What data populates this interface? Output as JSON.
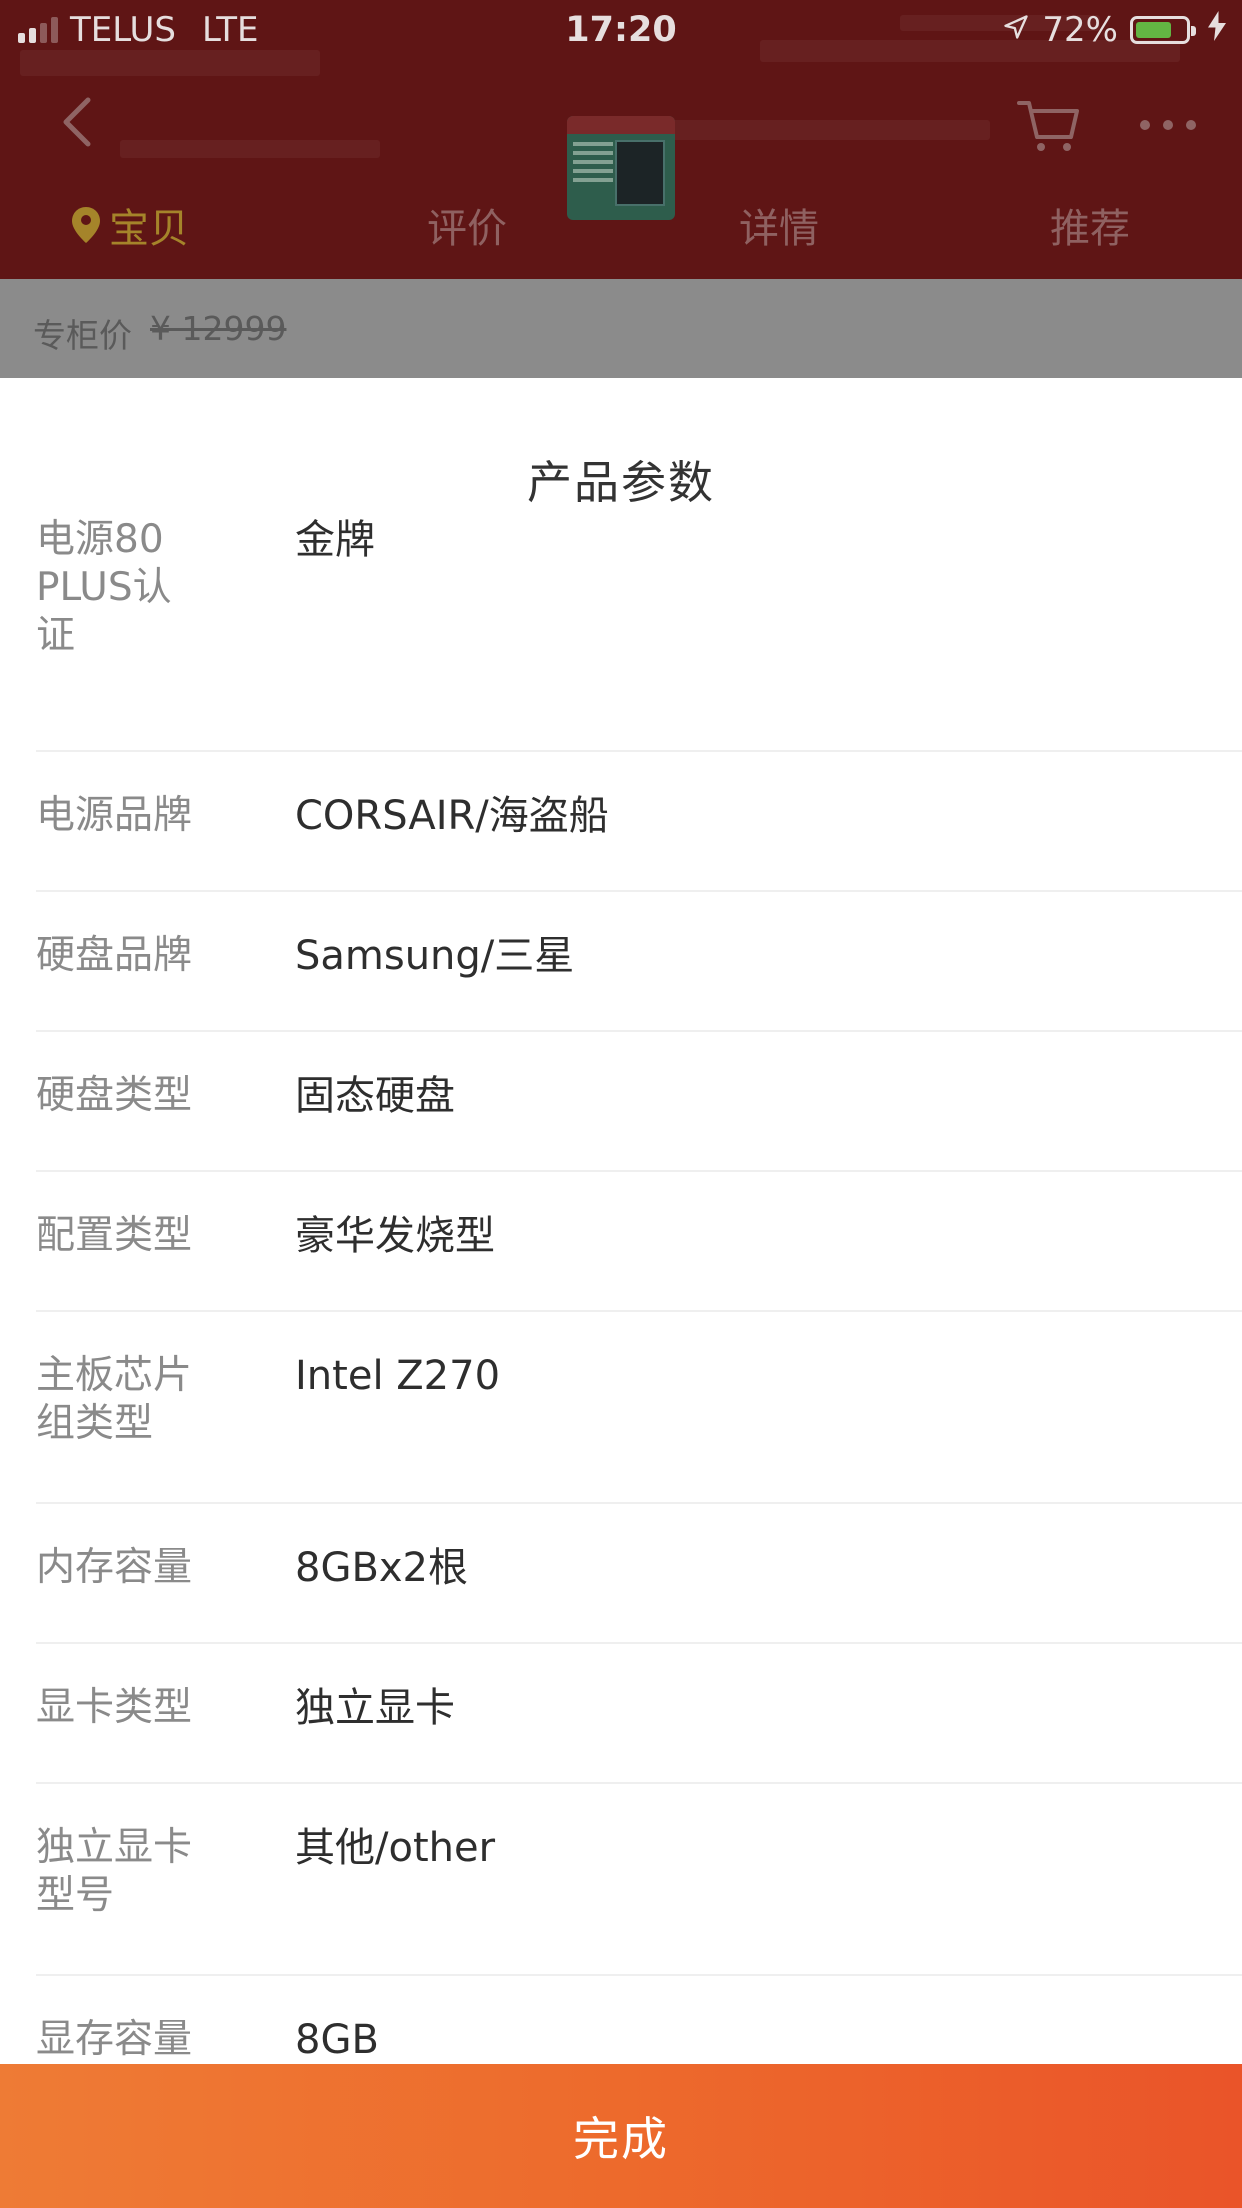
{
  "status_bar": {
    "carrier": "TELUS",
    "network": "LTE",
    "time": "17:20",
    "battery": "72%",
    "battery_level": 0.72
  },
  "nav": {
    "back_icon": "chevron-left-icon",
    "thumbnail": "product-thumbnail",
    "cart_icon": "cart-icon",
    "more_icon": "more-icon"
  },
  "tabs": [
    {
      "label": "宝贝",
      "active": true
    },
    {
      "label": "评价",
      "active": false
    },
    {
      "label": "详情",
      "active": false
    },
    {
      "label": "推荐",
      "active": false
    }
  ],
  "price_strip": {
    "label": "专柜价",
    "price": "¥ 12999"
  },
  "sheet": {
    "title": "产品参数",
    "params": [
      {
        "key": "电源80\nPLUS认\n证",
        "value": "金牌"
      },
      {
        "key": "电源品牌",
        "value": "CORSAIR/海盗船"
      },
      {
        "key": "硬盘品牌",
        "value": "Samsung/三星"
      },
      {
        "key": "硬盘类型",
        "value": "固态硬盘"
      },
      {
        "key": "配置类型",
        "value": "豪华发烧型"
      },
      {
        "key": "主板芯片\n组类型",
        "value": "Intel Z270"
      },
      {
        "key": "内存容量",
        "value": "8GBx2根"
      },
      {
        "key": "显卡类型",
        "value": "独立显卡"
      },
      {
        "key": "独立显卡\n型号",
        "value": "其他/other"
      },
      {
        "key": "显存容量",
        "value": "8GB"
      }
    ]
  },
  "done_button": {
    "label": "完成"
  },
  "colors": {
    "accent": "#ee6a2c",
    "header_dim": "#5f1515",
    "active_tab": "#a5842a"
  }
}
